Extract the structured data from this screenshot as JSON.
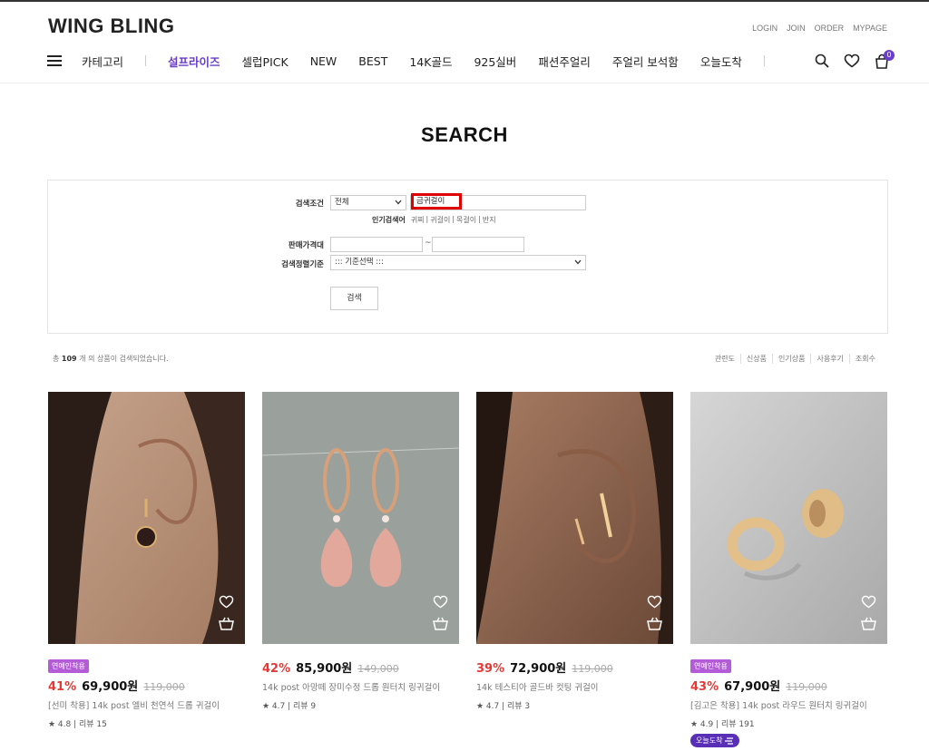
{
  "brand": {
    "logo": "WING BLING",
    "accent": "#6a3ec9"
  },
  "util": [
    "LOGIN",
    "JOIN",
    "ORDER",
    "MYPAGE"
  ],
  "nav": {
    "category": "카테고리",
    "items": [
      "설프라이즈",
      "셀럽PICK",
      "NEW",
      "BEST",
      "14K골드",
      "925실버",
      "패션주얼리",
      "주얼리 보석함",
      "오늘도착"
    ],
    "cart_count": "0"
  },
  "page": {
    "title": "SEARCH"
  },
  "search": {
    "cond_label": "검색조건",
    "cond_value": "전체",
    "keyword": "금귀걸이",
    "popular_label": "인기검색어",
    "popular": [
      "귀찌",
      "귀걸이",
      "목걸이",
      "반지"
    ],
    "price_label": "판매가격대",
    "price_sep": "~",
    "sort_label": "검색정렬기준",
    "sort_value": "::: 기준선택 :::",
    "button": "검색"
  },
  "results": {
    "prefix": "총",
    "count": "109",
    "suffix": "개 의 상품이 검색되었습니다.",
    "sort_options": [
      "관련도",
      "신상품",
      "인기상품",
      "사용후기",
      "조회수"
    ]
  },
  "products": [
    {
      "badge": "연예인착용",
      "discount": "41%",
      "price": "69,900원",
      "original": "119,000",
      "name": "[선미 착용] 14k post 엘비 천연석 드롭 귀걸이",
      "review": "★ 4.8 | 리뷰 15",
      "today": ""
    },
    {
      "badge": "",
      "discount": "42%",
      "price": "85,900원",
      "original": "149,000",
      "name": "14k post 아망떼 장미수정 드롭 원터치 링귀걸이",
      "review": "★ 4.7 | 리뷰 9",
      "today": ""
    },
    {
      "badge": "",
      "discount": "39%",
      "price": "72,900원",
      "original": "119,000",
      "name": "14k 테스티아 골드바 컷팅 귀걸이",
      "review": "★ 4.7 | 리뷰 3",
      "today": ""
    },
    {
      "badge": "연예인착용",
      "discount": "43%",
      "price": "67,900원",
      "original": "119,000",
      "name": "[김고은 착용] 14k post 라우드 원터치 링귀걸이",
      "review": "★ 4.9 | 리뷰 191",
      "today": "오늘도착"
    }
  ]
}
